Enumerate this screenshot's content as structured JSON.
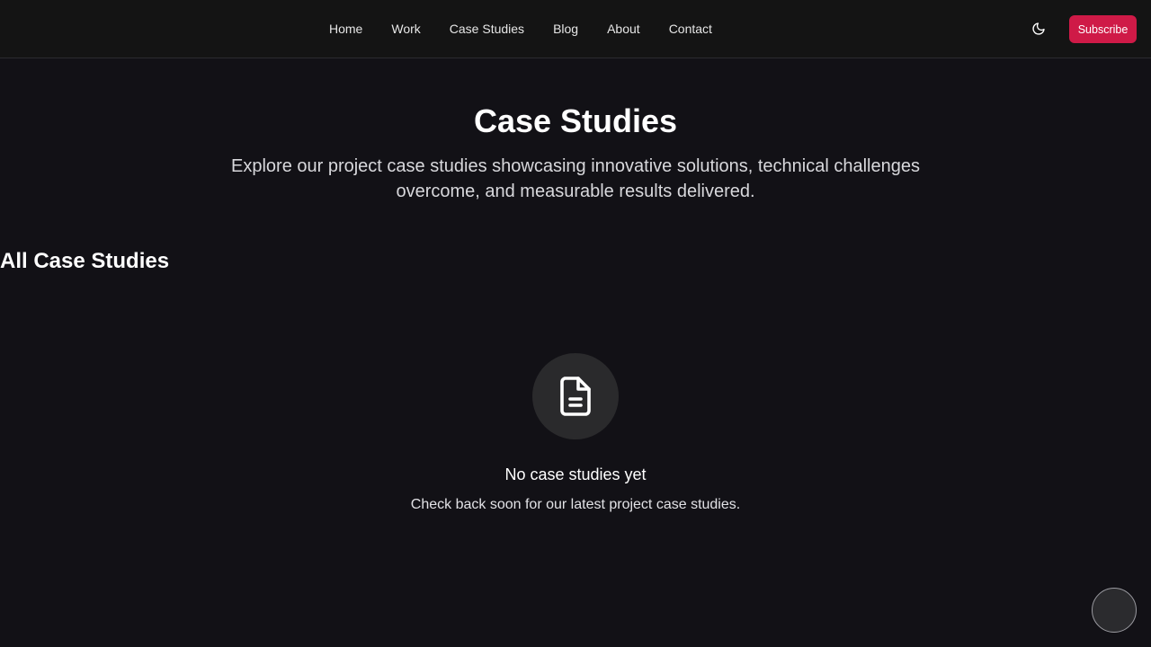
{
  "nav": {
    "items": [
      {
        "label": "Home"
      },
      {
        "label": "Work"
      },
      {
        "label": "Case Studies"
      },
      {
        "label": "Blog"
      },
      {
        "label": "About"
      },
      {
        "label": "Contact"
      }
    ]
  },
  "header": {
    "theme_toggle_icon": "moon-icon",
    "subscribe_label": "Subscribe",
    "subscribe_color": "#cf1a47"
  },
  "hero": {
    "title": "Case Studies",
    "subtitle": "Explore our project case studies showcasing innovative solutions, technical challenges overcome, and measurable results delivered."
  },
  "section": {
    "title": "All Case Studies"
  },
  "empty_state": {
    "icon": "document-icon",
    "title": "No case studies yet",
    "text": "Check back soon for our latest project case studies."
  },
  "colors": {
    "background": "#121116",
    "header_background": "#141414",
    "accent": "#cf1a47"
  }
}
